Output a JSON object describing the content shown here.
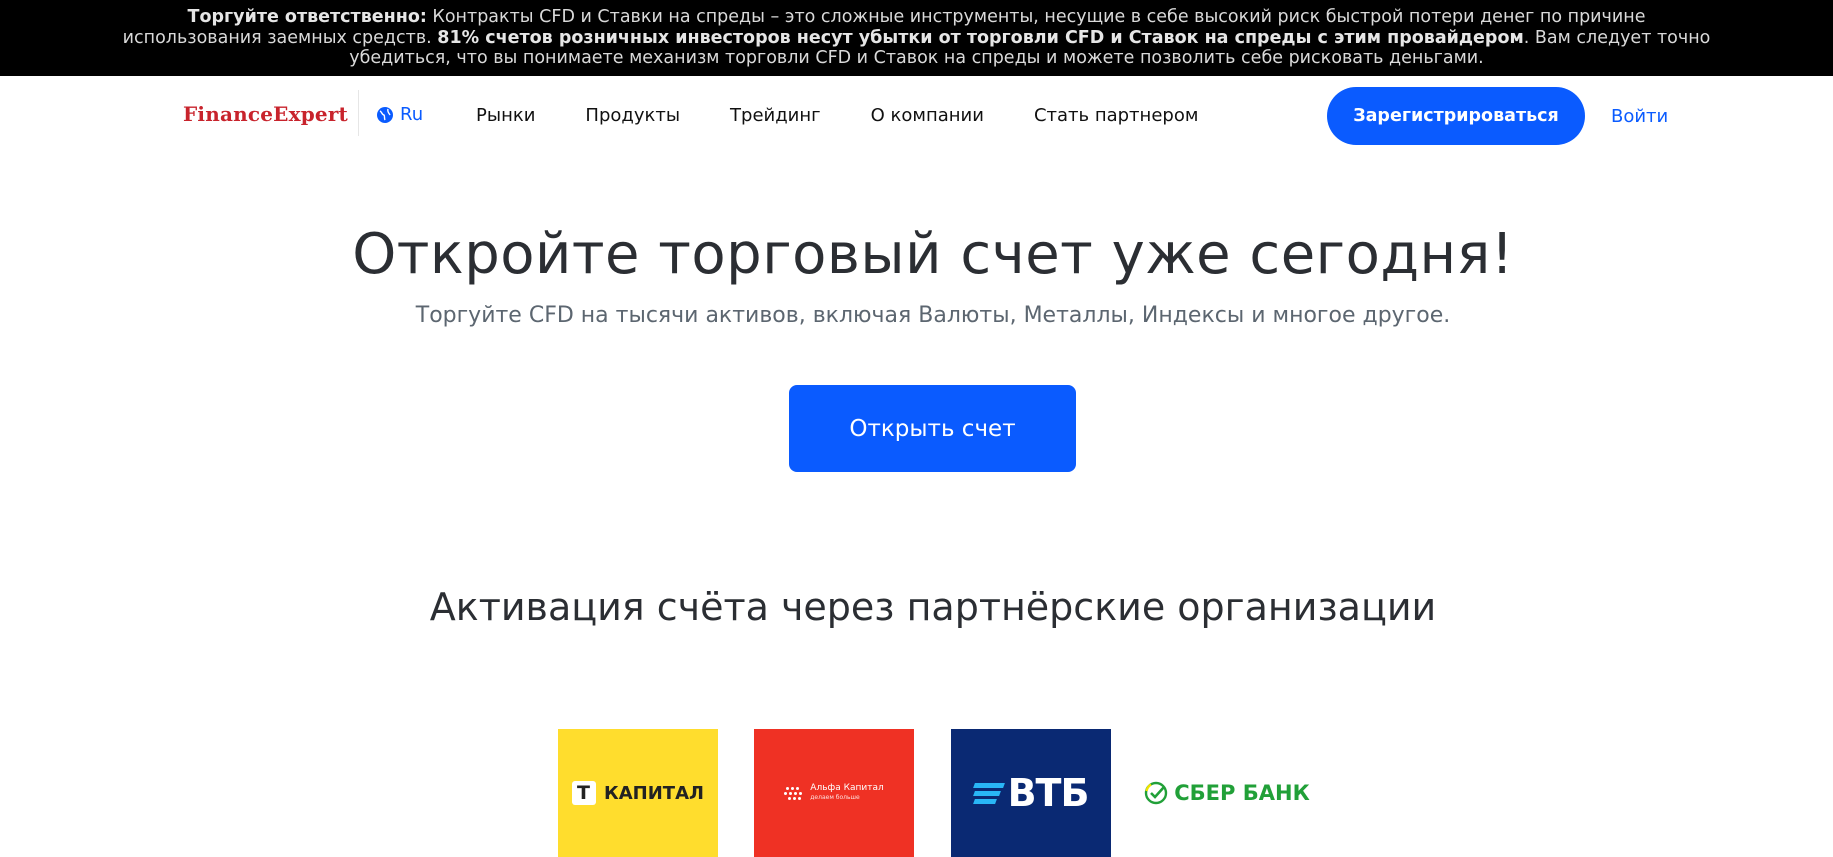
{
  "risk_warning": {
    "lead": "Торгуйте ответственно:",
    "line1_rest": " Контракты CFD и Ставки на спреды – это сложные инструменты, несущие в себе высокий риск быстрой потери денег по причине",
    "line2_start": "использования заемных средств. ",
    "line2_bold": "81% счетов розничных инвесторов несут убытки от торговли CFD и Ставок на спреды с этим провайдером",
    "line2_end": ". Вам следует точно",
    "line3": "убедиться, что вы понимаете механизм торговли CFD и Ставок на спреды и можете позволить себе рисковать деньгами."
  },
  "header": {
    "logo": "FinanceExpert",
    "language": "Ru",
    "nav": [
      "Рынки",
      "Продукты",
      "Трейдинг",
      "О компании",
      "Стать партнером"
    ],
    "register_label": "Зарегистрироваться",
    "login_label": "Войти"
  },
  "hero": {
    "title": "Откройте торговый счет уже сегодня!",
    "subtitle": "Торгуйте CFD на тысячи активов, включая Валюты, Металлы, Индексы и многое другое.",
    "cta_label": "Открыть счет"
  },
  "partners": {
    "title": "Активация счёта через партнёрские организации",
    "items": [
      {
        "name": "КАПИТАЛ",
        "icon": "t-shield-icon"
      },
      {
        "name": "Альфа Капитал",
        "tagline": "делаем больше",
        "icon": "alfa-dots-icon"
      },
      {
        "name": "ВТБ",
        "icon": "vtb-lines-icon"
      },
      {
        "name": "СБЕР БАНК",
        "icon": "sber-check-icon"
      }
    ]
  },
  "colors": {
    "accent": "#0a5bff",
    "logo": "#c8232c",
    "tbank": "#ffdd2d",
    "alfa": "#ef3124",
    "vtb": "#0a2973",
    "sber": "#21a038"
  }
}
